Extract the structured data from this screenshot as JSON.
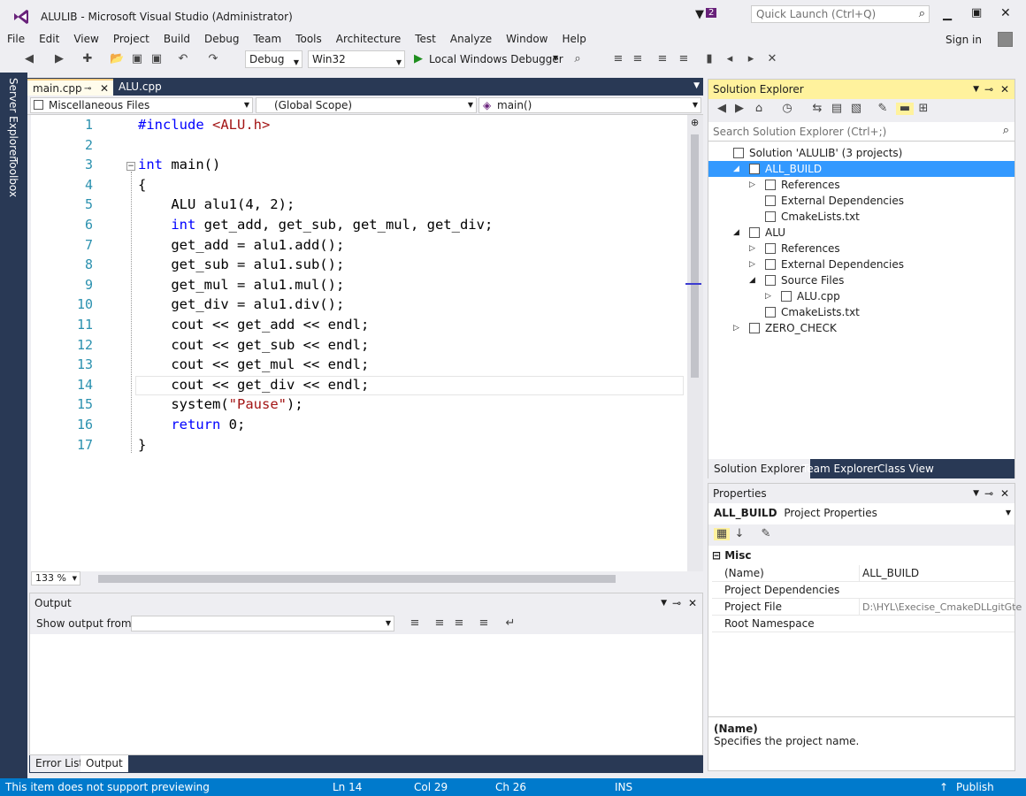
{
  "window": {
    "title": "ALULIB - Microsoft Visual Studio (Administrator)",
    "filter_badge": "2",
    "quick_launch_placeholder": "Quick Launch (Ctrl+Q)",
    "sign_in": "Sign in"
  },
  "menu": [
    "File",
    "Edit",
    "View",
    "Project",
    "Build",
    "Debug",
    "Team",
    "Tools",
    "Architecture",
    "Test",
    "Analyze",
    "Window",
    "Help"
  ],
  "toolbar": {
    "config": "Debug",
    "platform": "Win32",
    "debugger": "Local Windows Debugger"
  },
  "sidebar": {
    "server_explorer": "Server Explorer",
    "toolbox": "Toolbox"
  },
  "editor": {
    "tabs": [
      {
        "label": "main.cpp",
        "active": true
      },
      {
        "label": "ALU.cpp",
        "active": false
      }
    ],
    "nav": {
      "project": "Miscellaneous Files",
      "scope": "(Global Scope)",
      "member": "main()"
    },
    "zoom": "133 %",
    "lines": [
      {
        "n": "1",
        "html": "<span class=\"kw\">#include</span> <span class=\"str\">&lt;ALU.h&gt;</span>"
      },
      {
        "n": "2",
        "html": ""
      },
      {
        "n": "3",
        "html": "<span class=\"kw\">int</span> main()"
      },
      {
        "n": "4",
        "html": "{"
      },
      {
        "n": "5",
        "html": "    ALU alu1(4, 2);"
      },
      {
        "n": "6",
        "html": "    <span class=\"kw\">int</span> get_add, get_sub, get_mul, get_div;"
      },
      {
        "n": "7",
        "html": "    get_add = alu1.add();"
      },
      {
        "n": "8",
        "html": "    get_sub = alu1.sub();"
      },
      {
        "n": "9",
        "html": "    get_mul = alu1.mul();"
      },
      {
        "n": "10",
        "html": "    get_div = alu1.div();"
      },
      {
        "n": "11",
        "html": "    cout &lt;&lt; get_add &lt;&lt; endl;"
      },
      {
        "n": "12",
        "html": "    cout &lt;&lt; get_sub &lt;&lt; endl;"
      },
      {
        "n": "13",
        "html": "    cout &lt;&lt; get_mul &lt;&lt; endl;"
      },
      {
        "n": "14",
        "html": "    cout &lt;&lt; get_div &lt;&lt; endl;"
      },
      {
        "n": "15",
        "html": "    system(<span class=\"str\">\"Pause\"</span>);"
      },
      {
        "n": "16",
        "html": "    <span class=\"kw\">return</span> 0;"
      },
      {
        "n": "17",
        "html": "}"
      }
    ]
  },
  "output": {
    "title": "Output",
    "show_from_label": "Show output from:",
    "tabs": [
      "Error List",
      "Output"
    ]
  },
  "solution_explorer": {
    "title": "Solution Explorer",
    "search_placeholder": "Search Solution Explorer (Ctrl+;)",
    "items": [
      {
        "label": "Solution 'ALULIB' (3 projects)",
        "indent": 0,
        "exp": ""
      },
      {
        "label": "ALL_BUILD",
        "indent": 1,
        "exp": "◢",
        "selected": true
      },
      {
        "label": "References",
        "indent": 2,
        "exp": "▷"
      },
      {
        "label": "External Dependencies",
        "indent": 2,
        "exp": ""
      },
      {
        "label": "CmakeLists.txt",
        "indent": 2,
        "exp": ""
      },
      {
        "label": "ALU",
        "indent": 1,
        "exp": "◢"
      },
      {
        "label": "References",
        "indent": 2,
        "exp": "▷"
      },
      {
        "label": "External Dependencies",
        "indent": 2,
        "exp": "▷"
      },
      {
        "label": "Source Files",
        "indent": 2,
        "exp": "◢"
      },
      {
        "label": "ALU.cpp",
        "indent": 3,
        "exp": "▷"
      },
      {
        "label": "CmakeLists.txt",
        "indent": 2,
        "exp": ""
      },
      {
        "label": "ZERO_CHECK",
        "indent": 1,
        "exp": "▷"
      }
    ],
    "bottom_tabs": [
      "Solution Explorer",
      "Team Explorer",
      "Class View"
    ]
  },
  "properties": {
    "title": "Properties",
    "object": "ALL_BUILD",
    "object_type": "Project Properties",
    "category": "Misc",
    "rows": [
      {
        "name": "(Name)",
        "value": "ALL_BUILD"
      },
      {
        "name": "Project Dependencies",
        "value": ""
      },
      {
        "name": "Project File",
        "value": "D:\\HYL\\Execise_CmakeDLLgitGte"
      },
      {
        "name": "Root Namespace",
        "value": ""
      }
    ],
    "desc_title": "(Name)",
    "desc_text": "Specifies the project name."
  },
  "status": {
    "message": "This item does not support previewing",
    "ln": "Ln 14",
    "col": "Col 29",
    "ch": "Ch 26",
    "mode": "INS",
    "publish": "Publish"
  },
  "colors": {
    "accent": "#007acc",
    "selected": "#3399ff",
    "frame": "#293955",
    "keyword": "#0000ff",
    "string": "#a31515",
    "linenum": "#2b91af"
  }
}
